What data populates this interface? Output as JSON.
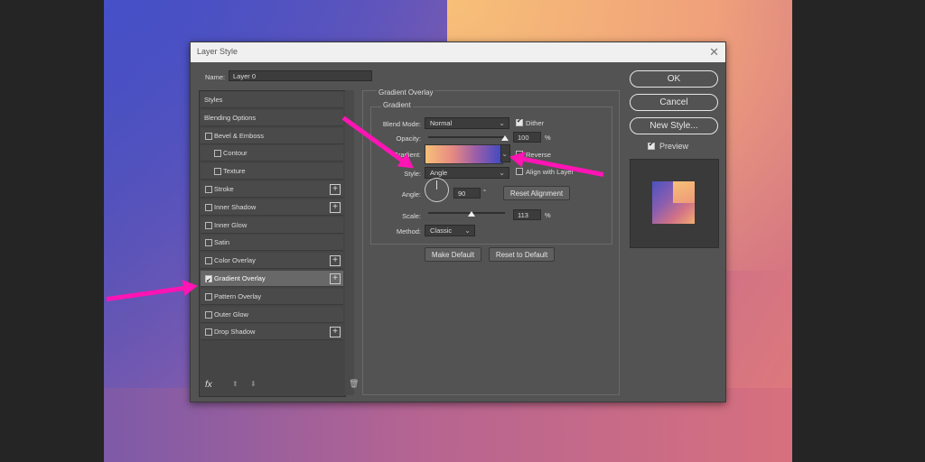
{
  "dialog": {
    "title": "Layer Style",
    "name_label": "Name:",
    "name_value": "Layer 0"
  },
  "styles_list": {
    "items": [
      {
        "label": "Styles",
        "checkbox": false,
        "checked": false,
        "plus": false,
        "indent": false,
        "active": false
      },
      {
        "label": "Blending Options",
        "checkbox": false,
        "checked": false,
        "plus": false,
        "indent": false,
        "active": false
      },
      {
        "label": "Bevel & Emboss",
        "checkbox": true,
        "checked": false,
        "plus": false,
        "indent": false,
        "active": false
      },
      {
        "label": "Contour",
        "checkbox": true,
        "checked": false,
        "plus": false,
        "indent": true,
        "active": false
      },
      {
        "label": "Texture",
        "checkbox": true,
        "checked": false,
        "plus": false,
        "indent": true,
        "active": false
      },
      {
        "label": "Stroke",
        "checkbox": true,
        "checked": false,
        "plus": true,
        "indent": false,
        "active": false
      },
      {
        "label": "Inner Shadow",
        "checkbox": true,
        "checked": false,
        "plus": true,
        "indent": false,
        "active": false
      },
      {
        "label": "Inner Glow",
        "checkbox": true,
        "checked": false,
        "plus": false,
        "indent": false,
        "active": false
      },
      {
        "label": "Satin",
        "checkbox": true,
        "checked": false,
        "plus": false,
        "indent": false,
        "active": false
      },
      {
        "label": "Color Overlay",
        "checkbox": true,
        "checked": false,
        "plus": true,
        "indent": false,
        "active": false
      },
      {
        "label": "Gradient Overlay",
        "checkbox": true,
        "checked": true,
        "plus": true,
        "indent": false,
        "active": true
      },
      {
        "label": "Pattern Overlay",
        "checkbox": true,
        "checked": false,
        "plus": false,
        "indent": false,
        "active": false
      },
      {
        "label": "Outer Glow",
        "checkbox": true,
        "checked": false,
        "plus": false,
        "indent": false,
        "active": false
      },
      {
        "label": "Drop Shadow",
        "checkbox": true,
        "checked": false,
        "plus": true,
        "indent": false,
        "active": false
      }
    ],
    "footer": {
      "fx": "fx",
      "up": "⬆",
      "down": "⬇",
      "trash": "🗑"
    }
  },
  "gradient_overlay": {
    "section_title": "Gradient Overlay",
    "group_title": "Gradient",
    "blend_mode_label": "Blend Mode:",
    "blend_mode_value": "Normal",
    "dither_label": "Dither",
    "dither_checked": true,
    "opacity_label": "Opacity:",
    "opacity_value": "100",
    "percent": "%",
    "gradient_label": "Gradient:",
    "reverse_label": "Reverse",
    "reverse_checked": false,
    "style_label": "Style:",
    "style_value": "Angle",
    "align_label": "Align with Layer",
    "align_checked": false,
    "angle_label": "Angle:",
    "angle_value": "90",
    "degree": "°",
    "reset_alignment": "Reset Alignment",
    "scale_label": "Scale:",
    "scale_value": "113",
    "method_label": "Method:",
    "method_value": "Classic",
    "make_default": "Make Default",
    "reset_default": "Reset to Default",
    "opacity_fraction": 1.0,
    "scale_fraction": 0.57
  },
  "actions": {
    "ok": "OK",
    "cancel": "Cancel",
    "new_style": "New Style...",
    "preview_label": "Preview",
    "preview_checked": true
  },
  "colors": {
    "annotation_arrow": "#ff14b4",
    "dialog_bg": "#535353"
  }
}
